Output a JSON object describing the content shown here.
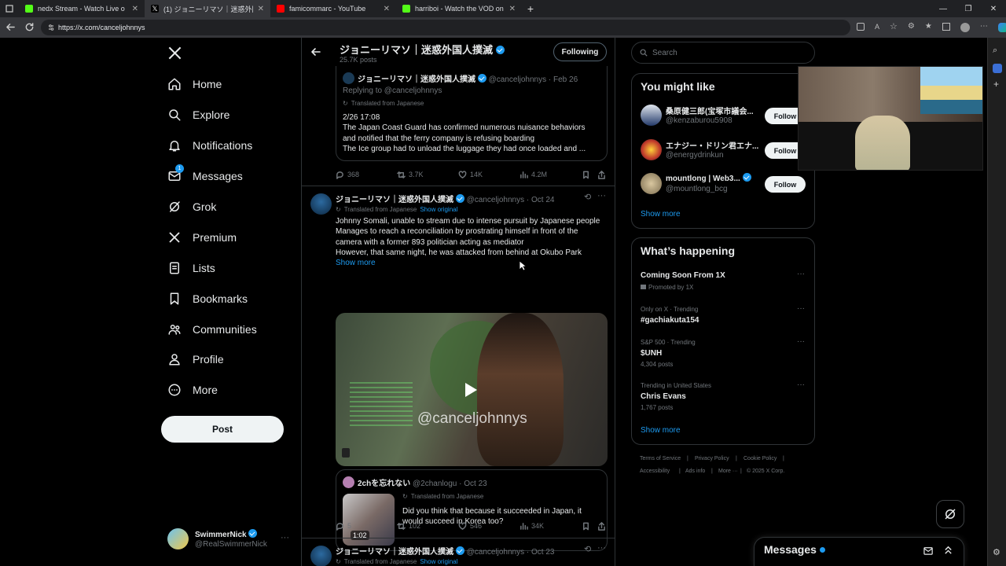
{
  "browser": {
    "tabs": [
      {
        "title": "nedx Stream - Watch Live o",
        "color": "#53fc18",
        "active": false
      },
      {
        "title": "(1) ジョニーリマソ｜迷惑外国人撲滅",
        "color": "#ffffff",
        "active": true
      },
      {
        "title": "famicommarc - YouTube",
        "color": "#ff0000",
        "active": false
      },
      {
        "title": "harriboi - Watch the VOD on Kick",
        "color": "#53fc18",
        "active": false
      }
    ],
    "url": "https://x.com/canceljohnnys"
  },
  "nav": {
    "items": [
      {
        "label": "Home"
      },
      {
        "label": "Explore"
      },
      {
        "label": "Notifications"
      },
      {
        "label": "Messages",
        "badge": "1"
      },
      {
        "label": "Grok"
      },
      {
        "label": "Premium"
      },
      {
        "label": "Lists"
      },
      {
        "label": "Bookmarks"
      },
      {
        "label": "Communities"
      },
      {
        "label": "Profile"
      },
      {
        "label": "More"
      }
    ],
    "post_label": "Post",
    "account": {
      "name": "SwimmerNick",
      "handle": "@RealSwimmerNick"
    }
  },
  "profile_header": {
    "name": "ジョニーリマソ｜迷惑外国人撲滅",
    "posts": "25.7K posts",
    "following_label": "Following"
  },
  "tweet1": {
    "quote": {
      "name": "ジョニーリマソ｜迷惑外国人撲滅",
      "handle": "@canceljohnnys",
      "date": "Feb 26",
      "replying": "Replying to @canceljohnnys",
      "translated": "Translated from Japanese",
      "lines": [
        "2/26 17:08",
        "The Japan Coast Guard has confirmed numerous nuisance behaviors",
        "and notified that the ferry company is refusing boarding",
        "The Ice group had to unload the luggage they had once loaded and ..."
      ]
    },
    "stats": {
      "replies": "368",
      "reposts": "3.7K",
      "likes": "14K",
      "views": "4.2M"
    }
  },
  "tweet2": {
    "name": "ジョニーリマソ｜迷惑外国人撲滅",
    "handle": "@canceljohnnys",
    "date": "Oct 24",
    "translated": "Translated from Japanese",
    "show_original": "Show original",
    "lines": [
      "Johnny Somali, unable to stream due to intense pursuit by Japanese people",
      "Manages to reach a reconciliation by prostrating himself in front of the",
      "camera with a former 893 politician acting as mediator",
      "However, that same night, he was attacked from behind at Okubo Park"
    ],
    "show_more": "Show more",
    "video_watermark": "@canceljohnnys",
    "quote": {
      "name": "2chを忘れない",
      "handle": "@2chanlogu",
      "date": "Oct 23",
      "translated": "Translated from Japanese",
      "lines": [
        "Did you think that because it succeeded in Japan, it",
        "would succeed in Korea too?"
      ],
      "duration": "1:02"
    },
    "stats": {
      "replies": "5",
      "reposts": "102",
      "likes": "546",
      "views": "34K"
    }
  },
  "tweet3": {
    "name": "ジョニーリマソ｜迷惑外国人撲滅",
    "handle": "@canceljohnnys",
    "date": "Oct 23",
    "translated": "Translated from Japanese",
    "show_original": "Show original"
  },
  "right": {
    "search_placeholder": "Search",
    "you_might_like": {
      "title": "You might like",
      "users": [
        {
          "name": "桑原健三郎(宝塚市議会...",
          "handle": "@kenzaburou5908",
          "follow": "Follow"
        },
        {
          "name": "エナジー・ドリン君エナ...",
          "handle": "@energydrinkun",
          "follow": "Follow"
        },
        {
          "name": "mountlong | Web3...",
          "handle": "@mountlong_bcg",
          "follow": "Follow"
        }
      ],
      "show_more": "Show more"
    },
    "whats_happening": {
      "title": "What’s happening",
      "trends": [
        {
          "meta": "",
          "name": "Coming Soon From 1X",
          "sub": "Promoted by 1X"
        },
        {
          "meta": "Only on X · Trending",
          "name": "#gachiakuta154",
          "sub": ""
        },
        {
          "meta": "S&P 500 · Trending",
          "name": "$UNH",
          "sub": "4,304 posts"
        },
        {
          "meta": "Trending in United States",
          "name": "Chris Evans",
          "sub": "1,767 posts"
        }
      ],
      "show_more": "Show more"
    },
    "footer": [
      "Terms of Service",
      "Privacy Policy",
      "Cookie Policy",
      "Accessibility",
      "Ads info",
      "More ···",
      "© 2025 X Corp."
    ]
  },
  "messages_drawer": {
    "title": "Messages"
  },
  "colors": {
    "accent": "#1d9bf0",
    "background": "#000000",
    "border": "#2f3336"
  }
}
